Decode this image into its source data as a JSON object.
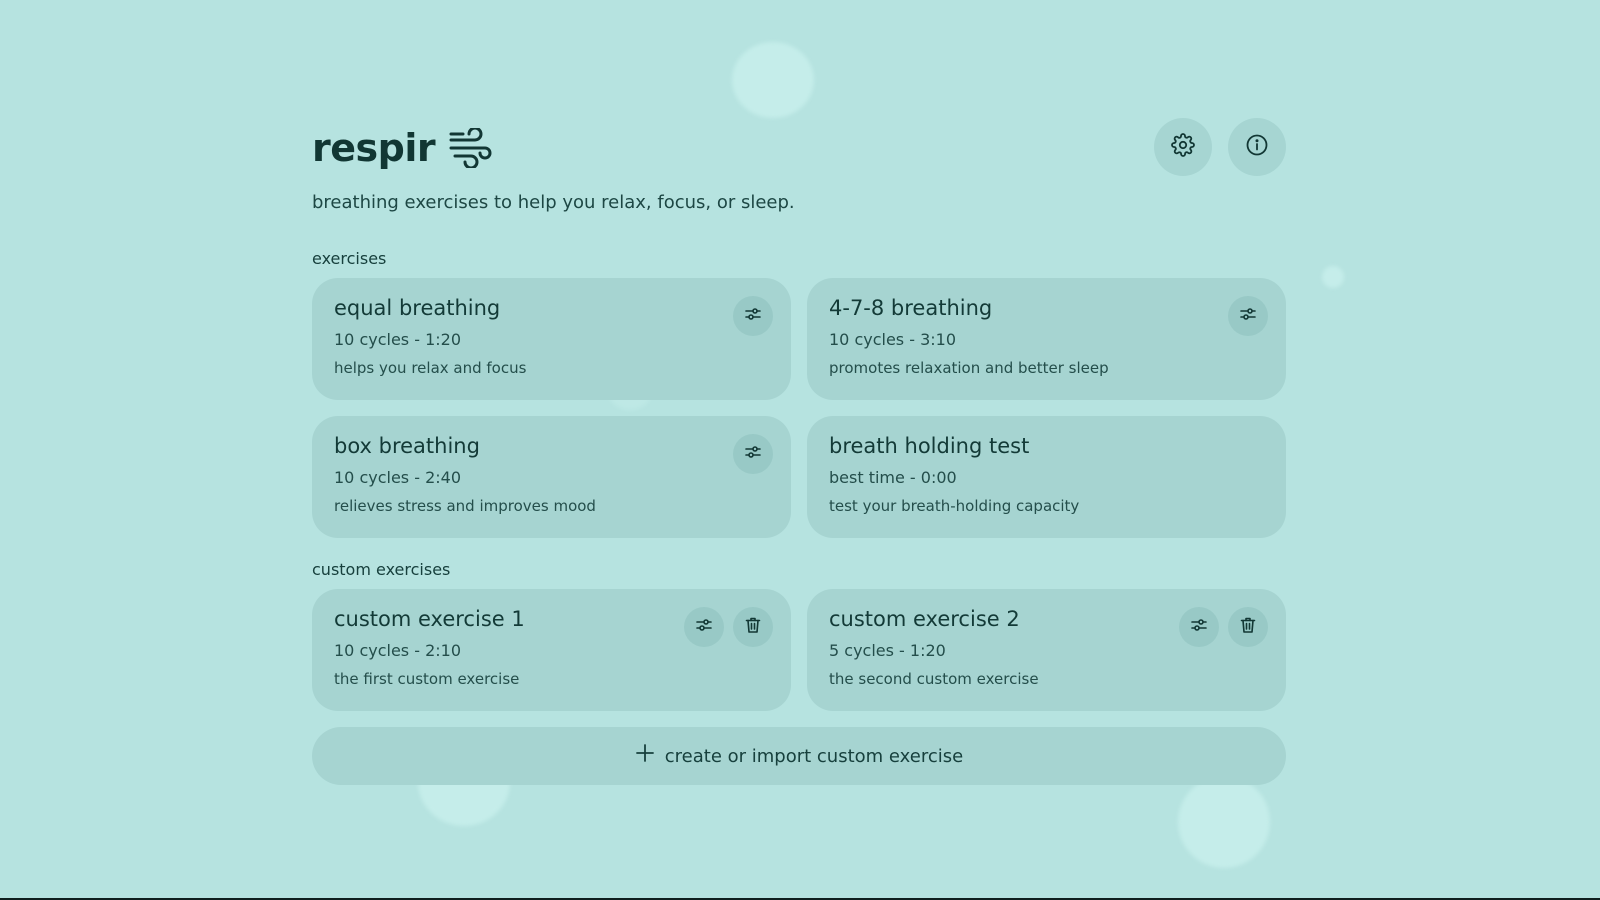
{
  "app": {
    "title": "respir",
    "title_icon": "wind-icon",
    "subtitle": "breathing exercises to help you relax, focus, or sleep.",
    "header_buttons": [
      {
        "icon": "gear-icon"
      },
      {
        "icon": "info-icon"
      }
    ]
  },
  "sections": {
    "exercises_label": "exercises",
    "custom_label": "custom exercises"
  },
  "exercises": [
    {
      "title": "equal breathing",
      "meta": "10 cycles - 1:20",
      "desc": "helps you relax and focus"
    },
    {
      "title": "4-7-8 breathing",
      "meta": "10 cycles - 3:10",
      "desc": "promotes relaxation and better sleep"
    },
    {
      "title": "box breathing",
      "meta": "10 cycles - 2:40",
      "desc": "relieves stress and improves mood"
    },
    {
      "title": "breath holding test",
      "meta": "best time - 0:00",
      "desc": "test your breath-holding capacity"
    }
  ],
  "custom_exercises": [
    {
      "title": "custom exercise 1",
      "meta": "10 cycles - 2:10",
      "desc": "the first custom exercise"
    },
    {
      "title": "custom exercise 2",
      "meta": "5 cycles - 1:20",
      "desc": "the second custom exercise"
    }
  ],
  "create_button": {
    "icon": "plus-icon",
    "label": "create or import custom exercise"
  },
  "colors": {
    "background": "#b6e3e0",
    "card": "#a6d4d1",
    "text": "#17403d"
  }
}
